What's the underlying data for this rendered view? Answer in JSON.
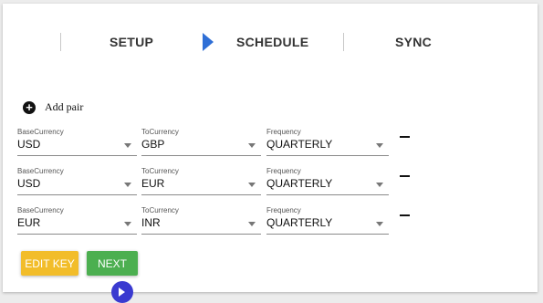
{
  "stepper": {
    "steps": [
      {
        "label": "SETUP"
      },
      {
        "label": "SCHEDULE",
        "active": true
      },
      {
        "label": "SYNC"
      }
    ],
    "active_indicator_color": "#2f6fd6"
  },
  "add_pair": {
    "label": "Add pair",
    "icon": "plus-circle-icon"
  },
  "pairs": [
    {
      "base_label": "BaseCurrency",
      "base_value": "USD",
      "to_label": "ToCurrency",
      "to_value": "GBP",
      "freq_label": "Frequency",
      "freq_value": "QUARTERLY"
    },
    {
      "base_label": "BaseCurrency",
      "base_value": "USD",
      "to_label": "ToCurrency",
      "to_value": "EUR",
      "freq_label": "Frequency",
      "freq_value": "QUARTERLY"
    },
    {
      "base_label": "BaseCurrency",
      "base_value": "EUR",
      "to_label": "ToCurrency",
      "to_value": "INR",
      "freq_label": "Frequency",
      "freq_value": "QUARTERLY"
    }
  ],
  "buttons": {
    "edit_key": {
      "label": "EDIT KEY",
      "color": "#f2bd2a"
    },
    "next": {
      "label": "NEXT",
      "color": "#4caf50"
    }
  }
}
